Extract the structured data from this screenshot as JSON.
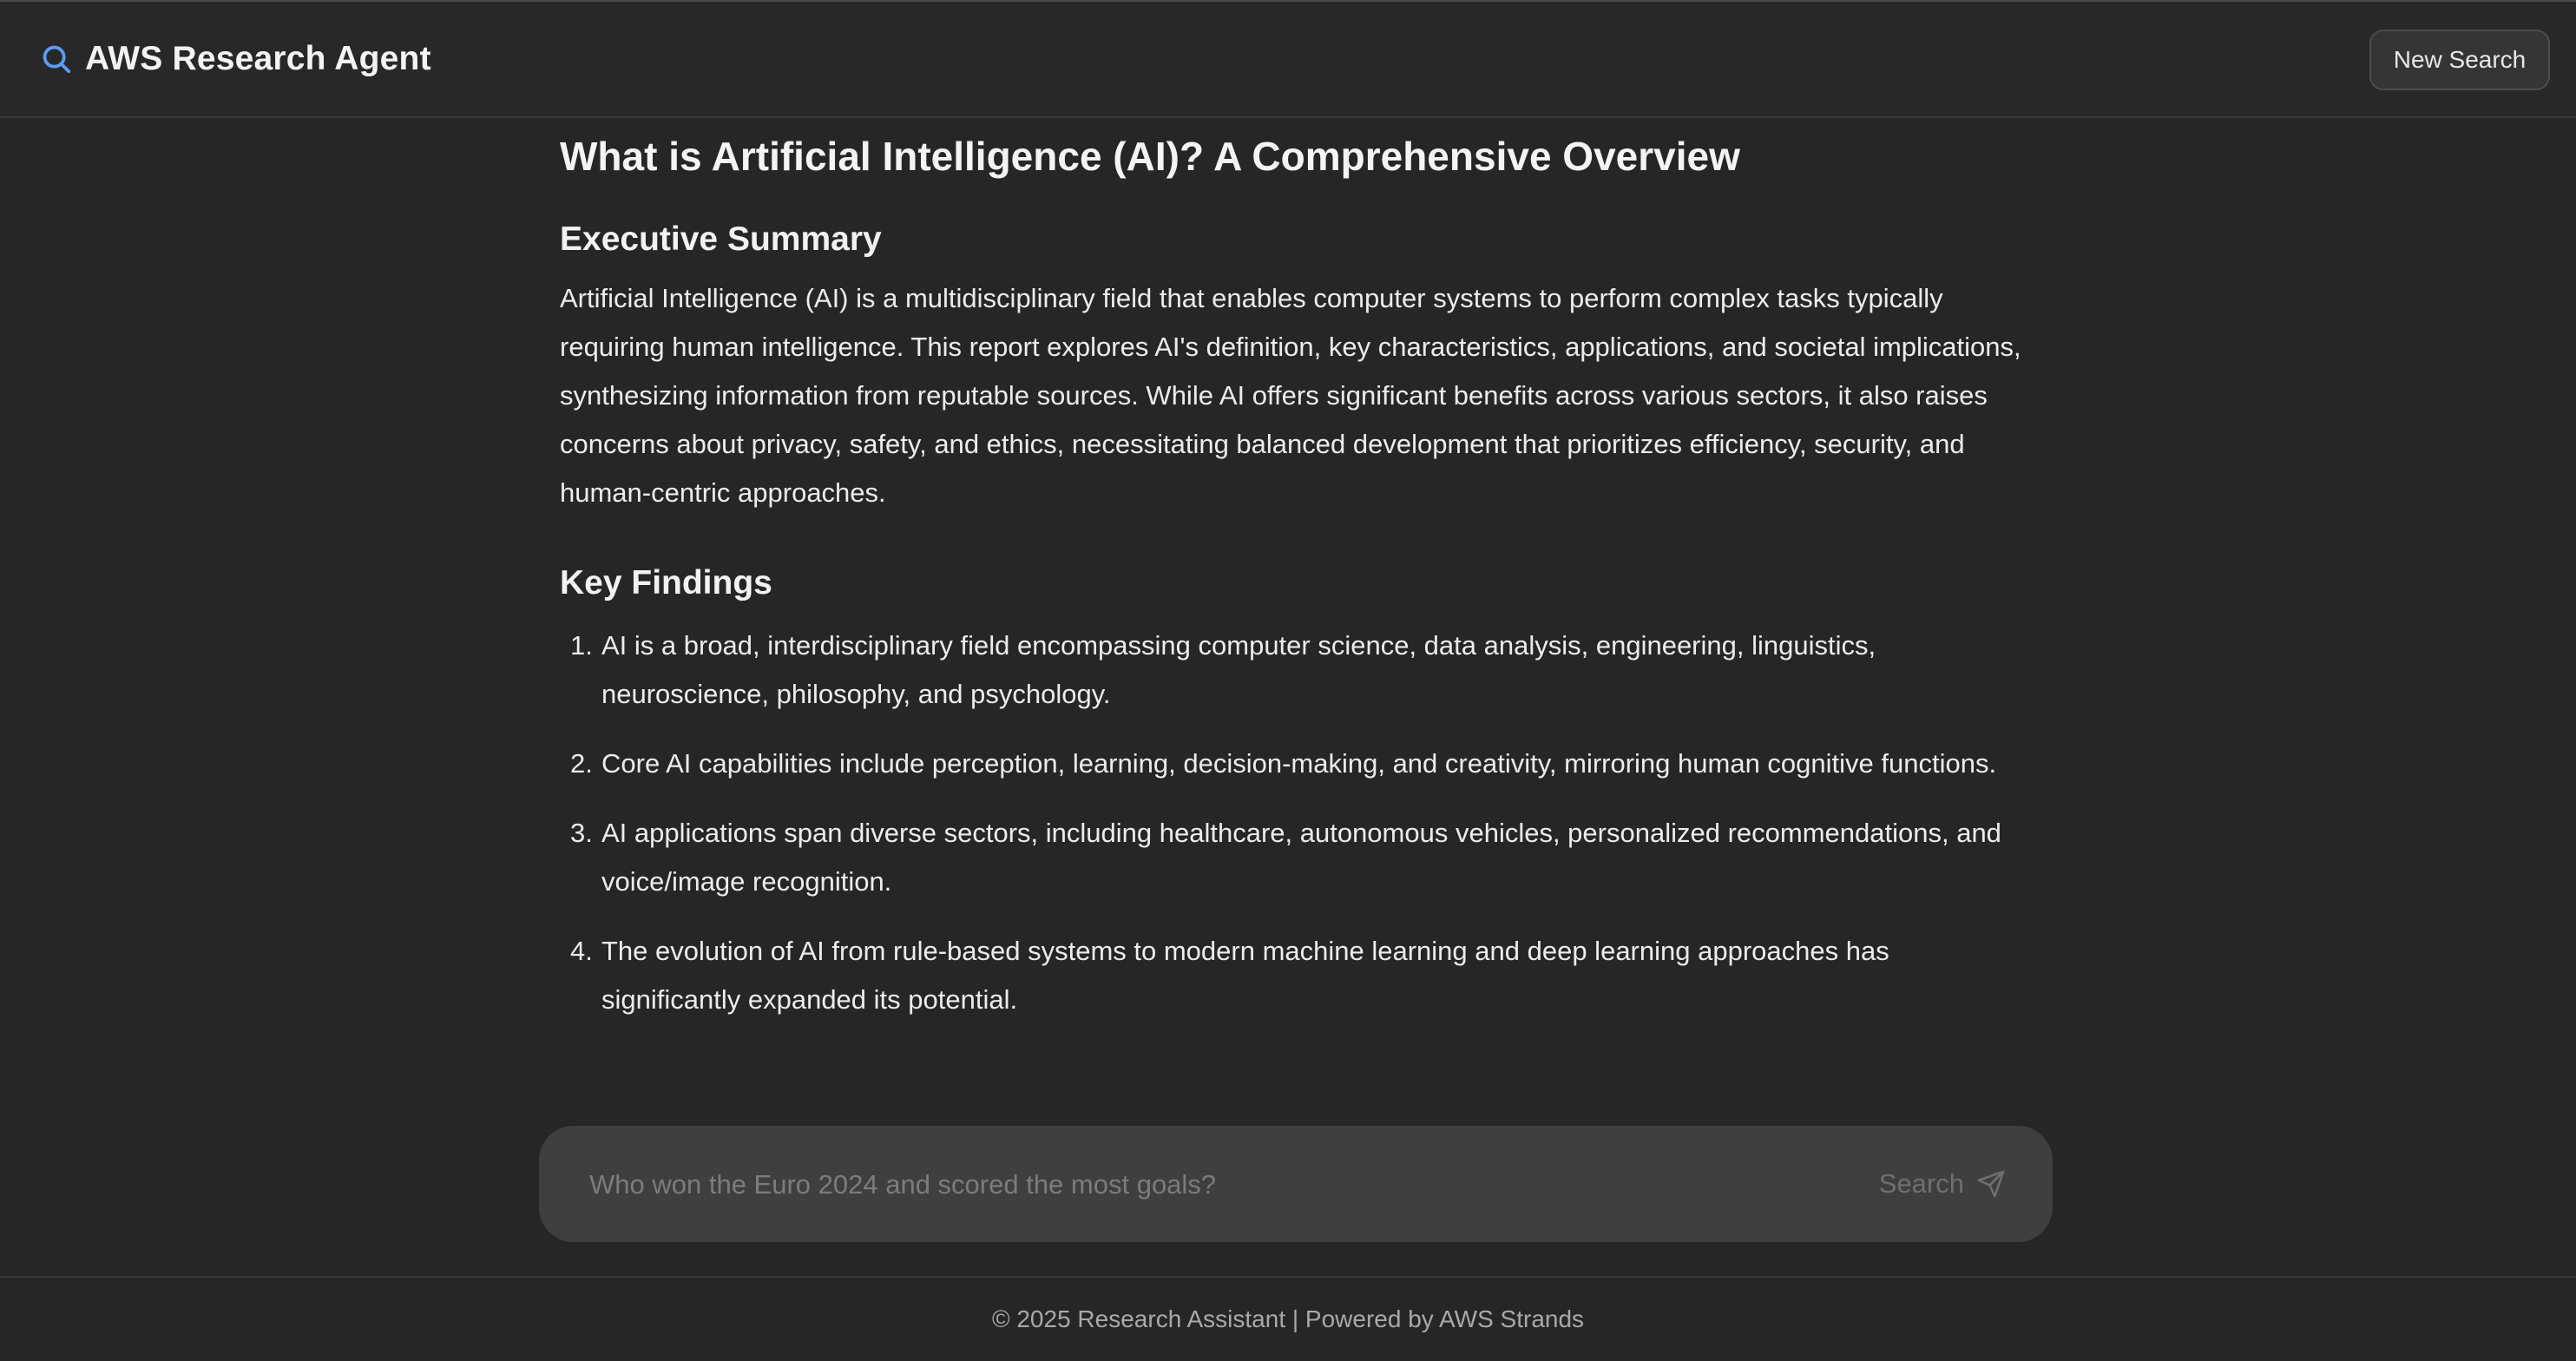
{
  "app": {
    "title": "AWS Research Agent",
    "accent_color": "#5b9cf5",
    "icon": "search-icon"
  },
  "header": {
    "new_search_label": "New Search"
  },
  "report": {
    "title": "What is Artificial Intelligence (AI)? A Comprehensive Overview",
    "executive_summary": {
      "heading": "Executive Summary",
      "text": "Artificial Intelligence (AI) is a multidisciplinary field that enables computer systems to perform complex tasks typically requiring human intelligence. This report explores AI's definition, key characteristics, applications, and societal implications, synthesizing information from reputable sources. While AI offers significant benefits across various sectors, it also raises concerns about privacy, safety, and ethics, necessitating balanced development that prioritizes efficiency, security, and human-centric approaches."
    },
    "key_findings": {
      "heading": "Key Findings",
      "items": [
        {
          "number": "1.",
          "text": "AI is a broad, interdisciplinary field encompassing computer science, data analysis, engineering, linguistics, neuroscience, philosophy, and psychology."
        },
        {
          "number": "2.",
          "text": "Core AI capabilities include perception, learning, decision-making, and creativity, mirroring human cognitive functions."
        },
        {
          "number": "3.",
          "text": "AI applications span diverse sectors, including healthcare, autonomous vehicles, personalized recommendations, and voice/image recognition."
        },
        {
          "number": "4.",
          "text": "The evolution of AI from rule-based systems to modern machine learning and deep learning approaches has significantly expanded its potential."
        }
      ]
    }
  },
  "search": {
    "value": "",
    "placeholder": "Who won the Euro 2024 and scored the most goals?",
    "button_label": "Search",
    "button_icon": "send-icon"
  },
  "footer": {
    "text": "© 2025 Research Assistant | Powered by AWS Strands"
  }
}
